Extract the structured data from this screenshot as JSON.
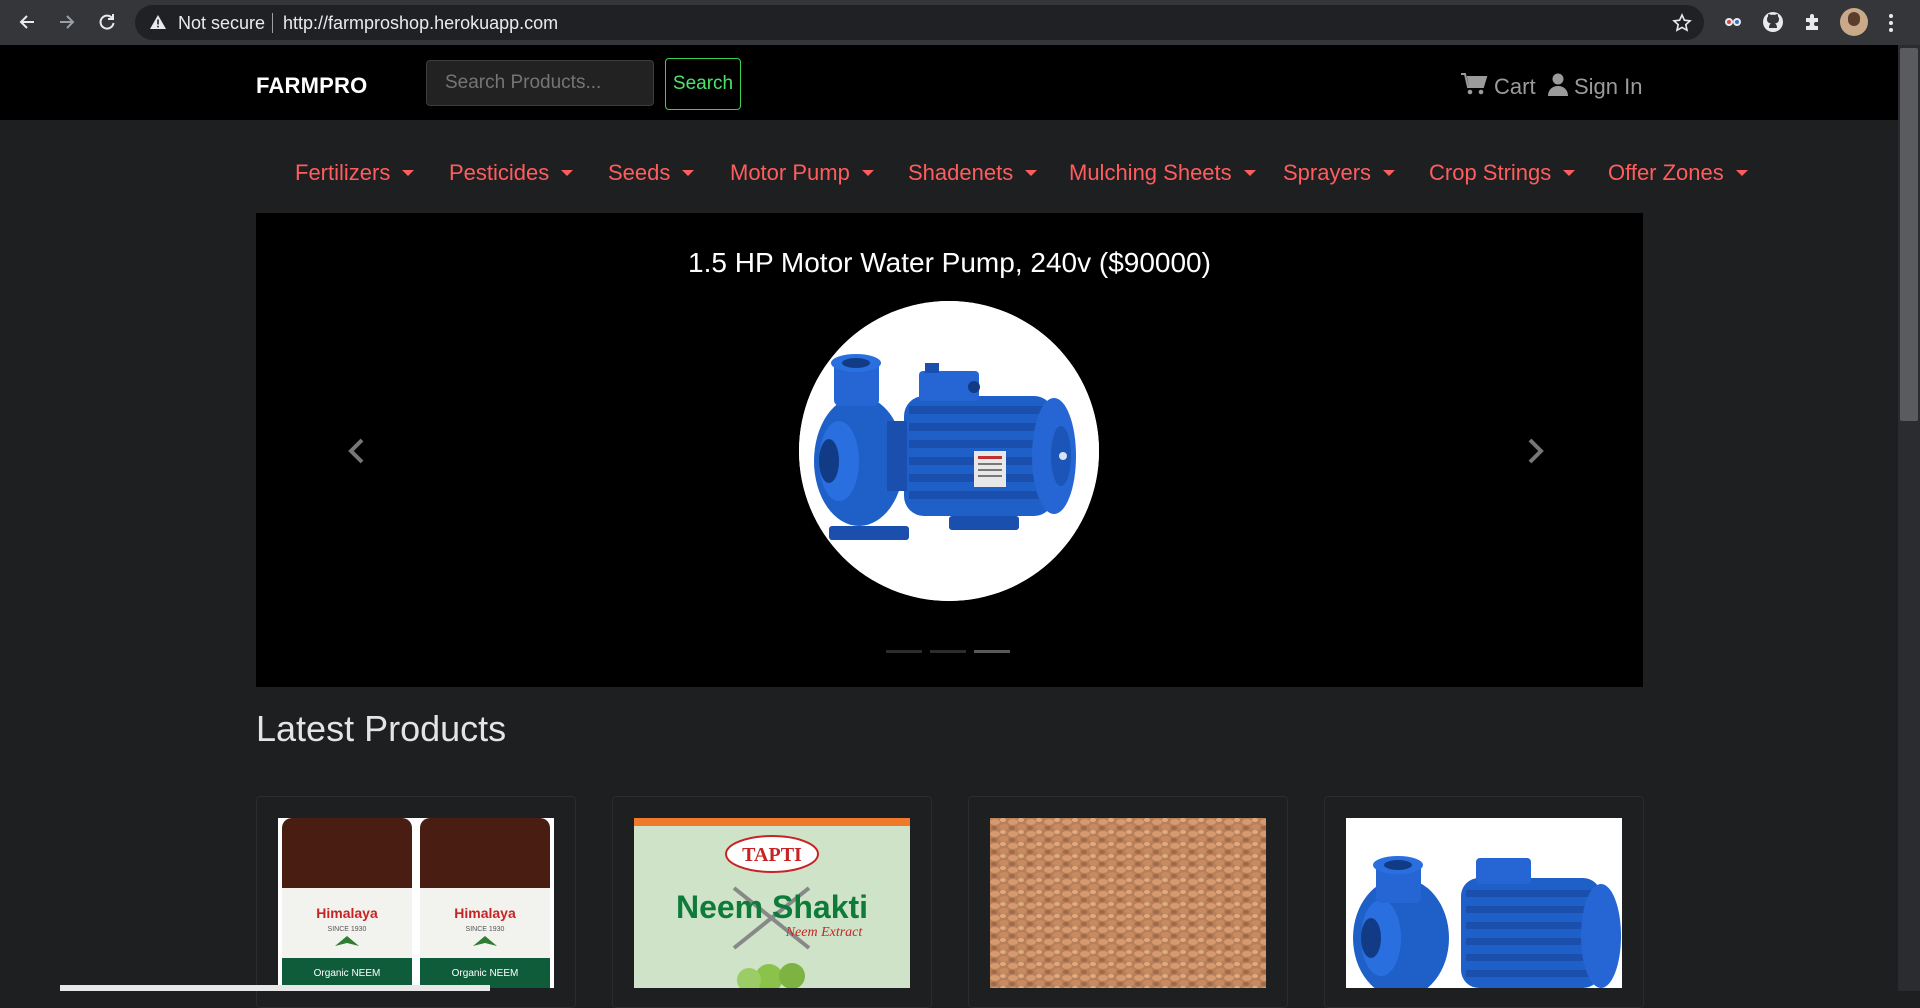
{
  "browser": {
    "security_label": "Not secure",
    "url": "http://farmproshop.herokuapp.com"
  },
  "header": {
    "brand": "FARMPRO",
    "search_placeholder": "Search Products...",
    "search_button": "Search",
    "cart_label": "Cart",
    "signin_label": "Sign In"
  },
  "categories": [
    {
      "label": "Fertilizers"
    },
    {
      "label": "Pesticides"
    },
    {
      "label": "Seeds"
    },
    {
      "label": "Motor Pump"
    },
    {
      "label": "Shadenets"
    },
    {
      "label": "Mulching Sheets"
    },
    {
      "label": "Sprayers"
    },
    {
      "label": "Crop Strings"
    },
    {
      "label": "Offer Zones"
    }
  ],
  "carousel": {
    "caption": "1.5 HP Motor Water Pump, 240v ($90000)",
    "slide_count": 3,
    "active_slide": 3
  },
  "latest": {
    "title": "Latest Products",
    "product_images": [
      {
        "icon": "himalaya-neem-bottles-image",
        "text_top": "Himalaya",
        "text_mid": "SINCE 1930",
        "text_label": "Organic NEEM"
      },
      {
        "icon": "neem-shakti-package-image",
        "text_top": "TAPTI",
        "text_mid": "Neem Shakti",
        "text_label": "Neem Extract"
      },
      {
        "icon": "seeds-image"
      },
      {
        "icon": "water-pump-image"
      }
    ]
  }
}
